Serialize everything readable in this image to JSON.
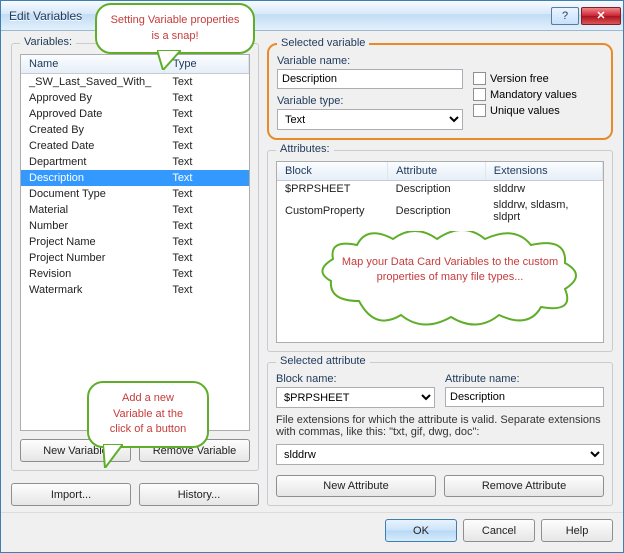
{
  "window": {
    "title": "Edit Variables"
  },
  "variables_group": {
    "legend": "Variables:"
  },
  "var_table": {
    "headers": {
      "name": "Name",
      "type": "Type"
    },
    "rows": [
      {
        "name": "_SW_Last_Saved_With_",
        "type": "Text",
        "selected": false
      },
      {
        "name": "Approved By",
        "type": "Text",
        "selected": false
      },
      {
        "name": "Approved Date",
        "type": "Text",
        "selected": false
      },
      {
        "name": "Created By",
        "type": "Text",
        "selected": false
      },
      {
        "name": "Created Date",
        "type": "Text",
        "selected": false
      },
      {
        "name": "Department",
        "type": "Text",
        "selected": false
      },
      {
        "name": "Description",
        "type": "Text",
        "selected": true
      },
      {
        "name": "Document Type",
        "type": "Text",
        "selected": false
      },
      {
        "name": "Material",
        "type": "Text",
        "selected": false
      },
      {
        "name": "Number",
        "type": "Text",
        "selected": false
      },
      {
        "name": "Project Name",
        "type": "Text",
        "selected": false
      },
      {
        "name": "Project Number",
        "type": "Text",
        "selected": false
      },
      {
        "name": "Revision",
        "type": "Text",
        "selected": false
      },
      {
        "name": "Watermark",
        "type": "Text",
        "selected": false
      }
    ]
  },
  "left_buttons": {
    "new_variable": "New Variable",
    "remove_variable": "Remove Variable",
    "import": "Import...",
    "history": "History..."
  },
  "selected_variable": {
    "legend": "Selected variable",
    "name_label": "Variable name:",
    "name_value": "Description",
    "type_label": "Variable type:",
    "type_value": "Text",
    "version_free_label": "Version free",
    "mandatory_label": "Mandatory values",
    "unique_label": "Unique values"
  },
  "attributes": {
    "legend": "Attributes:",
    "headers": {
      "block": "Block",
      "attribute": "Attribute",
      "extensions": "Extensions"
    },
    "rows": [
      {
        "block": "$PRPSHEET",
        "attribute": "Description",
        "extensions": "slddrw"
      },
      {
        "block": "CustomProperty",
        "attribute": "Description",
        "extensions": "slddrw, sldasm, sldprt"
      }
    ]
  },
  "selected_attribute": {
    "legend": "Selected attribute",
    "block_label": "Block name:",
    "block_value": "$PRPSHEET",
    "attr_label": "Attribute name:",
    "attr_value": "Description",
    "ext_hint": "File extensions for which the attribute is valid. Separate extensions with commas, like this: \"txt, gif, dwg, doc\":",
    "ext_value": "slddrw",
    "new_attribute": "New Attribute",
    "remove_attribute": "Remove Attribute"
  },
  "footer": {
    "ok": "OK",
    "cancel": "Cancel",
    "help": "Help"
  },
  "callouts": {
    "top": "Setting Variable properties is a snap!",
    "left": "Add a new Variable at the click of a button",
    "cloud": "Map your Data Card Variables to the custom properties of many file types..."
  }
}
